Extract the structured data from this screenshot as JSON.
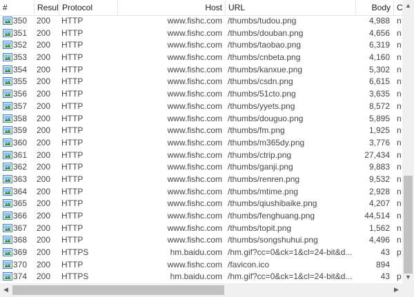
{
  "columns": [
    "#",
    "Result",
    "Protocol",
    "Host",
    "URL",
    "Body",
    "C"
  ],
  "rows": [
    {
      "num": "350",
      "result": "200",
      "protocol": "HTTP",
      "host": "www.fishc.com",
      "url": "/thumbs/tudou.png",
      "body": "4,988",
      "ct": "n"
    },
    {
      "num": "351",
      "result": "200",
      "protocol": "HTTP",
      "host": "www.fishc.com",
      "url": "/thumbs/douban.png",
      "body": "4,656",
      "ct": "n"
    },
    {
      "num": "352",
      "result": "200",
      "protocol": "HTTP",
      "host": "www.fishc.com",
      "url": "/thumbs/taobao.png",
      "body": "6,319",
      "ct": "n"
    },
    {
      "num": "353",
      "result": "200",
      "protocol": "HTTP",
      "host": "www.fishc.com",
      "url": "/thumbs/cnbeta.png",
      "body": "4,160",
      "ct": "n"
    },
    {
      "num": "354",
      "result": "200",
      "protocol": "HTTP",
      "host": "www.fishc.com",
      "url": "/thumbs/kanxue.png",
      "body": "5,302",
      "ct": "n"
    },
    {
      "num": "355",
      "result": "200",
      "protocol": "HTTP",
      "host": "www.fishc.com",
      "url": "/thumbs/csdn.png",
      "body": "6,615",
      "ct": "n"
    },
    {
      "num": "356",
      "result": "200",
      "protocol": "HTTP",
      "host": "www.fishc.com",
      "url": "/thumbs/51cto.png",
      "body": "3,635",
      "ct": "n"
    },
    {
      "num": "357",
      "result": "200",
      "protocol": "HTTP",
      "host": "www.fishc.com",
      "url": "/thumbs/yyets.png",
      "body": "8,572",
      "ct": "n"
    },
    {
      "num": "358",
      "result": "200",
      "protocol": "HTTP",
      "host": "www.fishc.com",
      "url": "/thumbs/douguo.png",
      "body": "5,895",
      "ct": "n"
    },
    {
      "num": "359",
      "result": "200",
      "protocol": "HTTP",
      "host": "www.fishc.com",
      "url": "/thumbs/fm.png",
      "body": "1,925",
      "ct": "n"
    },
    {
      "num": "360",
      "result": "200",
      "protocol": "HTTP",
      "host": "www.fishc.com",
      "url": "/thumbs/m365dy.png",
      "body": "3,776",
      "ct": "n"
    },
    {
      "num": "361",
      "result": "200",
      "protocol": "HTTP",
      "host": "www.fishc.com",
      "url": "/thumbs/ctrip.png",
      "body": "27,434",
      "ct": "n"
    },
    {
      "num": "362",
      "result": "200",
      "protocol": "HTTP",
      "host": "www.fishc.com",
      "url": "/thumbs/ganji.png",
      "body": "9,883",
      "ct": "n"
    },
    {
      "num": "363",
      "result": "200",
      "protocol": "HTTP",
      "host": "www.fishc.com",
      "url": "/thumbs/renren.png",
      "body": "9,532",
      "ct": "n"
    },
    {
      "num": "364",
      "result": "200",
      "protocol": "HTTP",
      "host": "www.fishc.com",
      "url": "/thumbs/mtime.png",
      "body": "2,928",
      "ct": "n"
    },
    {
      "num": "365",
      "result": "200",
      "protocol": "HTTP",
      "host": "www.fishc.com",
      "url": "/thumbs/qiushibaike.png",
      "body": "4,207",
      "ct": "n"
    },
    {
      "num": "366",
      "result": "200",
      "protocol": "HTTP",
      "host": "www.fishc.com",
      "url": "/thumbs/fenghuang.png",
      "body": "44,514",
      "ct": "n"
    },
    {
      "num": "367",
      "result": "200",
      "protocol": "HTTP",
      "host": "www.fishc.com",
      "url": "/thumbs/topit.png",
      "body": "1,562",
      "ct": "n"
    },
    {
      "num": "368",
      "result": "200",
      "protocol": "HTTP",
      "host": "www.fishc.com",
      "url": "/thumbs/songshuhui.png",
      "body": "4,496",
      "ct": "n"
    },
    {
      "num": "369",
      "result": "200",
      "protocol": "HTTPS",
      "host": "hm.baidu.com",
      "url": "/hm.gif?cc=0&ck=1&cl=24-bit&d...",
      "body": "43",
      "ct": "p"
    },
    {
      "num": "370",
      "result": "200",
      "protocol": "HTTP",
      "host": "www.fishc.com",
      "url": "/favicon.ico",
      "body": "894",
      "ct": ""
    },
    {
      "num": "374",
      "result": "200",
      "protocol": "HTTPS",
      "host": "hm.baidu.com",
      "url": "/hm.gif?cc=0&ck=1&cl=24-bit&d...",
      "body": "43",
      "ct": "p"
    }
  ],
  "colors": {
    "text": "#444444",
    "header_text": "#1a1a1a",
    "scrollbar_track": "#f0f0f0",
    "scrollbar_thumb": "#c1c1c1",
    "icon_blue": "#3a78c8"
  },
  "icons": {
    "row": "image-file-icon",
    "scroll_up": "arrow-up-icon",
    "scroll_down": "arrow-down-icon",
    "scroll_left": "arrow-left-icon",
    "scroll_right": "arrow-right-icon"
  }
}
